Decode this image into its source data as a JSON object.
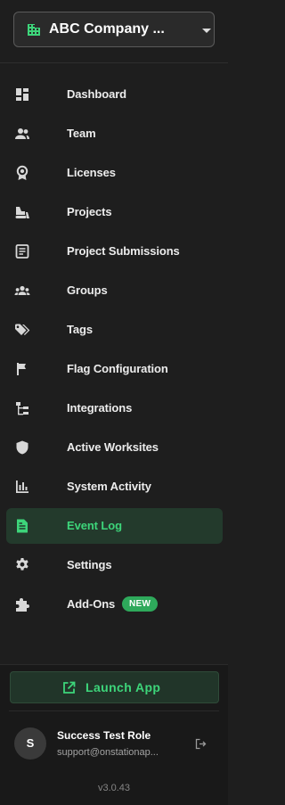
{
  "company_selector": {
    "name": "ABC Company ...",
    "icon": "building-icon",
    "dropdown_icon": "caret-down-icon"
  },
  "nav": {
    "items": [
      {
        "label": "Dashboard",
        "icon": "dashboard-icon"
      },
      {
        "label": "Team",
        "icon": "people-icon"
      },
      {
        "label": "Licenses",
        "icon": "award-icon"
      },
      {
        "label": "Projects",
        "icon": "bulldozer-icon"
      },
      {
        "label": "Project Submissions",
        "icon": "document-icon"
      },
      {
        "label": "Groups",
        "icon": "groups-icon"
      },
      {
        "label": "Tags",
        "icon": "tags-icon"
      },
      {
        "label": "Flag Configuration",
        "icon": "flag-icon"
      },
      {
        "label": "Integrations",
        "icon": "tree-icon"
      },
      {
        "label": "Active Worksites",
        "icon": "shield-icon"
      },
      {
        "label": "System Activity",
        "icon": "bar-chart-icon"
      },
      {
        "label": "Event Log",
        "icon": "file-text-icon",
        "active": true
      },
      {
        "label": "Settings",
        "icon": "gear-icon"
      },
      {
        "label": "Add-Ons",
        "icon": "puzzle-icon",
        "badge": "NEW"
      }
    ]
  },
  "launch_button": {
    "label": "Launch App",
    "icon": "external-link-icon"
  },
  "user": {
    "initial": "S",
    "name": "Success Test Role",
    "email": "support@onstationap...",
    "logout_icon": "logout-icon"
  },
  "version": "v3.0.43",
  "colors": {
    "accent": "#3dd57a",
    "active_bg": "#233a2c",
    "badge": "#2ea95b",
    "background": "#1e1e1e"
  }
}
